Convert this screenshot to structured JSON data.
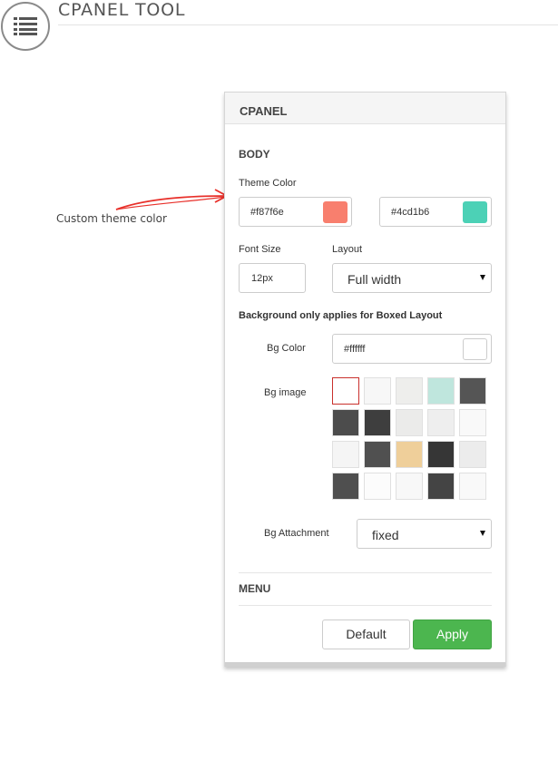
{
  "header": {
    "title": "CPANEL TOOL",
    "menu_icon": "list-icon"
  },
  "annotation": {
    "text": "Custom theme color",
    "arrow_color": "#e8302a"
  },
  "panel": {
    "title": "CPANEL",
    "body": {
      "title": "BODY",
      "theme_color_label": "Theme Color",
      "theme_colors": [
        {
          "value": "#f87f6e",
          "swatch": "#f87f6e"
        },
        {
          "value": "#4cd1b6",
          "swatch": "#4cd1b6"
        }
      ],
      "font_size_label": "Font Size",
      "font_size_value": "12px",
      "layout_label": "Layout",
      "layout_value": "Full width",
      "bg_note": "Background only applies for Boxed Layout",
      "bg_color_label": "Bg Color",
      "bg_color_value": "#ffffff",
      "bg_color_swatch": "#ffffff",
      "bg_image_label": "Bg image",
      "bg_images": [
        {
          "color": "#ffffff",
          "selected": true
        },
        {
          "color": "#f7f7f7",
          "selected": false
        },
        {
          "color": "#eeeeec",
          "selected": false
        },
        {
          "color": "#bfe6dd",
          "selected": false
        },
        {
          "color": "#555555",
          "selected": false
        },
        {
          "color": "#4c4c4c",
          "selected": false
        },
        {
          "color": "#3e3e3e",
          "selected": false
        },
        {
          "color": "#ebebea",
          "selected": false
        },
        {
          "color": "#eeeeee",
          "selected": false
        },
        {
          "color": "#f9f9f9",
          "selected": false
        },
        {
          "color": "#f5f5f5",
          "selected": false
        },
        {
          "color": "#505050",
          "selected": false
        },
        {
          "color": "#efcf9a",
          "selected": false
        },
        {
          "color": "#363636",
          "selected": false
        },
        {
          "color": "#ececec",
          "selected": false
        },
        {
          "color": "#4f4f4f",
          "selected": false
        },
        {
          "color": "#fcfcfc",
          "selected": false
        },
        {
          "color": "#f8f8f8",
          "selected": false
        },
        {
          "color": "#444444",
          "selected": false
        },
        {
          "color": "#f9f9f9",
          "selected": false
        }
      ],
      "bg_attachment_label": "Bg Attachment",
      "bg_attachment_value": "fixed"
    },
    "menu_title": "MENU",
    "buttons": {
      "default_label": "Default",
      "apply_label": "Apply"
    }
  }
}
